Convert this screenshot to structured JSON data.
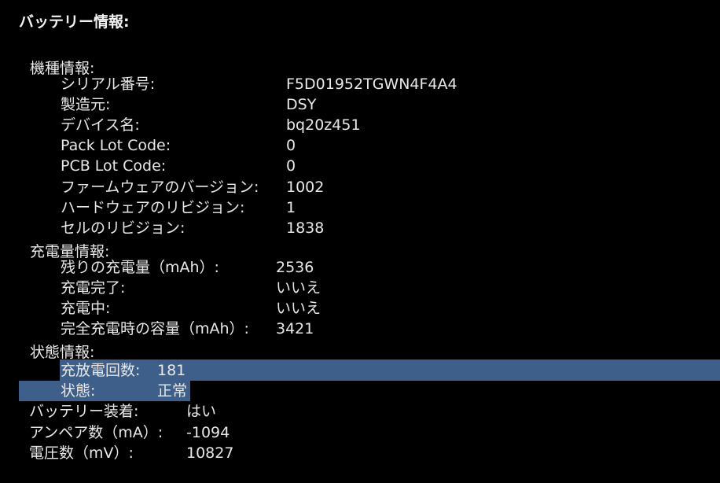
{
  "title": "バッテリー情報:",
  "model_info": {
    "heading": "機種情報:",
    "rows": [
      {
        "label": "シリアル番号:",
        "value": "F5D01952TGWN4F4A4"
      },
      {
        "label": "製造元:",
        "value": "DSY"
      },
      {
        "label": "デバイス名:",
        "value": "bq20z451"
      },
      {
        "label": "Pack Lot Code:",
        "value": "0"
      },
      {
        "label": "PCB Lot Code:",
        "value": "0"
      },
      {
        "label": "ファームウェアのバージョン:",
        "value": "1002"
      },
      {
        "label": "ハードウェアのリビジョン:",
        "value": "1"
      },
      {
        "label": "セルのリビジョン:",
        "value": "1838"
      }
    ]
  },
  "charge_info": {
    "heading": "充電量情報:",
    "rows": [
      {
        "label": "残りの充電量（mAh）:",
        "value": "2536"
      },
      {
        "label": "充電完了:",
        "value": "いいえ"
      },
      {
        "label": "充電中:",
        "value": "いいえ"
      },
      {
        "label": "完全充電時の容量（mAh）:",
        "value": "3421"
      }
    ]
  },
  "health_info": {
    "heading": "状態情報:",
    "rows": [
      {
        "label": "充放電回数:",
        "value": "181"
      },
      {
        "label": "状態:",
        "value": "正常"
      }
    ]
  },
  "top_rows": [
    {
      "label": "バッテリー装着:",
      "value": "はい"
    },
    {
      "label": "アンペア数（mA）:",
      "value": "-1094"
    },
    {
      "label": "電圧数（mV）:",
      "value": "10827"
    }
  ],
  "colors": {
    "background": "#000000",
    "text": "#e8e8e8",
    "selection": "#3e5f8a"
  }
}
